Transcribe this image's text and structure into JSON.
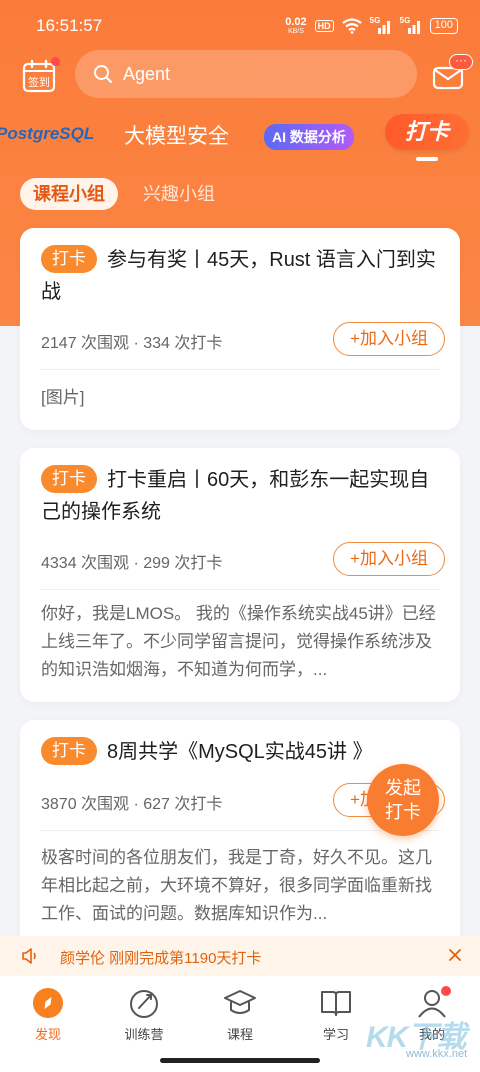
{
  "status_bar": {
    "time": "16:51:57",
    "net_speed_value": "0.02",
    "net_speed_unit": "KB/S",
    "hd_label": "HD",
    "sig1": "5G",
    "sig2": "5G",
    "battery": "100"
  },
  "header": {
    "checkin_label": "签到",
    "search_placeholder": "Agent",
    "mail_badge": "···"
  },
  "channels": {
    "items": [
      {
        "label": "PostgreSQL"
      },
      {
        "label": "大模型安全"
      },
      {
        "label": "AI 数据分析"
      },
      {
        "label": "打卡"
      }
    ],
    "active_index": 3
  },
  "subtabs": [
    {
      "label": "课程小组",
      "active": true
    },
    {
      "label": "兴趣小组",
      "active": false
    }
  ],
  "cards": [
    {
      "tag": "打卡",
      "title": "参与有奖丨45天，Rust 语言入门到实战",
      "stats": "2147 次围观 · 334 次打卡",
      "join_label": "+加入小组",
      "body": "[图片]"
    },
    {
      "tag": "打卡",
      "title": "打卡重启丨60天，和彭东一起实现自己的操作系统",
      "stats": "4334 次围观 · 299 次打卡",
      "join_label": "+加入小组",
      "body": "你好，我是LMOS。 我的《操作系统实战45讲》已经上线三年了。不少同学留言提问，觉得操作系统涉及的知识浩如烟海，不知道为何而学，..."
    },
    {
      "tag": "打卡",
      "title": "8周共学《MySQL实战45讲 》",
      "stats": "3870 次围观 · 627 次打卡",
      "join_label": "+加入小组",
      "body": "极客时间的各位朋友们，我是丁奇，好久不见。这几年相比起之前，大环境不算好，很多同学面临重新找工作、面试的问题。数据库知识作为..."
    }
  ],
  "fab": {
    "line1": "发起",
    "line2": "打卡"
  },
  "ticker": {
    "text": "颜学伦 刚刚完成第1190天打卡"
  },
  "bottom_nav": [
    {
      "label": "发现",
      "icon": "compass-icon",
      "active": true
    },
    {
      "label": "训练营",
      "icon": "rocket-icon",
      "active": false
    },
    {
      "label": "课程",
      "icon": "graduation-cap-icon",
      "active": false
    },
    {
      "label": "学习",
      "icon": "book-icon",
      "active": false
    },
    {
      "label": "我的",
      "icon": "user-icon",
      "active": false
    }
  ],
  "watermark": {
    "main": "KK下载",
    "sub": "www.kkx.net"
  },
  "colors": {
    "brand": "#fb7b3a",
    "accent": "#f06a19",
    "tag": "#fa8a2e"
  }
}
